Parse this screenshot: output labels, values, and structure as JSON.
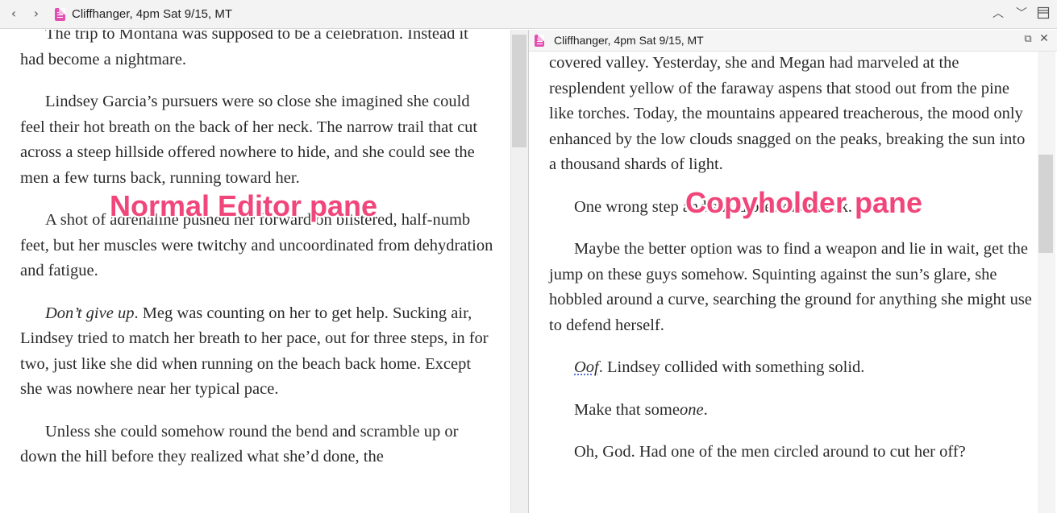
{
  "window": {
    "title": "Cliffhanger, 4pm Sat 9/15, MT",
    "icons": {
      "back": "chevron-left-icon",
      "forward": "chevron-right-icon",
      "prev": "chevron-up-icon",
      "next": "chevron-down-icon",
      "split": "split-view-icon"
    }
  },
  "copyholder": {
    "title": "Cliffhanger, 4pm Sat 9/15, MT",
    "icons": {
      "popout": "open-external-icon",
      "close": "close-icon"
    }
  },
  "editor": {
    "paragraphs": [
      {
        "text": "The trip to Montana was supposed to be a celebration. Instead it had become a nightmare."
      },
      {
        "text": "Lindsey Garcia’s pursuers were so close she imagined she could feel their hot breath on the back of her neck. The narrow trail that cut across a steep hillside offered nowhere to hide, and she could see the men a few turns back, running toward her."
      },
      {
        "text": "A shot of adrenaline pushed her forward on blistered, half-numb feet, but her muscles were twitchy and uncoordinated from dehydration and fatigue."
      },
      {
        "italic": "Don’t give up",
        "text": ". Meg was counting on her to get help. Sucking air, Lindsey tried to match her breath to her pace, out for three steps, in for two, just like she did when running on the beach back home. Except she was nowhere near her typical pace."
      },
      {
        "text": "Unless she could somehow round the bend and scramble up or down the hill before they realized what she’d done, the"
      }
    ]
  },
  "copyholder_text": {
    "paragraphs": [
      {
        "text": "covered valley. Yesterday, she and Megan had marveled at the resplendent yellow of the faraway aspens that stood out from the pine like torches. Today, the mountains appeared treacherous, the mood only enhanced by the low clouds snagged on the peaks, breaking the sun into a thousand shards of light."
      },
      {
        "text": "One wrong step and she’d break her neck."
      },
      {
        "text": "Maybe the better option was to find a weapon and lie in wait, get the jump on these guys somehow. Squinting against the sun’s glare, she hobbled around a curve, searching the ground for anything she might use to defend herself."
      },
      {
        "italic": "Oof",
        "text": ". Lindsey collided with something solid."
      },
      {
        "text": "Make that some",
        "italic_end": "one",
        "text_end": "."
      },
      {
        "text": "Oh, God. Had one of the men circled around to cut her off?"
      }
    ]
  },
  "annotations": {
    "left": "Normal Editor pane",
    "right": "Copyholder pane",
    "color": "#f0467a"
  }
}
